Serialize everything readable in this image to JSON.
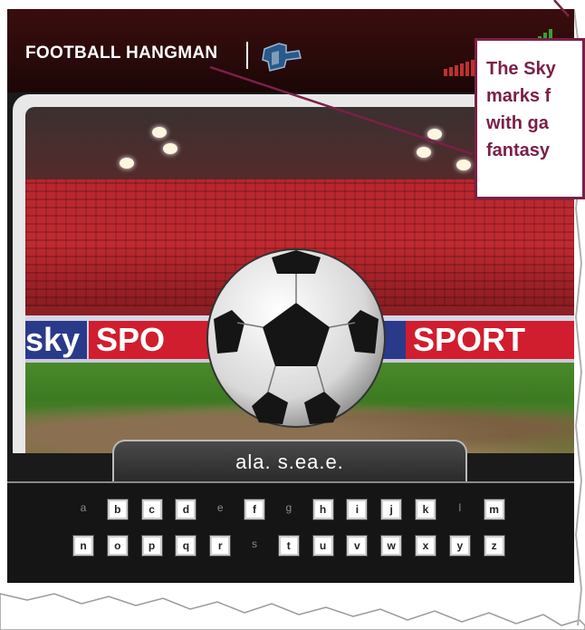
{
  "game": {
    "title": "FOOTBALL HANGMAN",
    "ad_boards": [
      "sky",
      "SPO",
      "SPORT"
    ],
    "masked_word": "ala. s.ea.e."
  },
  "keyboard": {
    "row1": [
      {
        "letter": "a",
        "used": true
      },
      {
        "letter": "b",
        "used": false
      },
      {
        "letter": "c",
        "used": false
      },
      {
        "letter": "d",
        "used": false
      },
      {
        "letter": "e",
        "used": true
      },
      {
        "letter": "f",
        "used": false
      },
      {
        "letter": "g",
        "used": true
      },
      {
        "letter": "h",
        "used": false
      },
      {
        "letter": "i",
        "used": false
      },
      {
        "letter": "j",
        "used": false
      },
      {
        "letter": "k",
        "used": false
      },
      {
        "letter": "l",
        "used": true
      },
      {
        "letter": "m",
        "used": false
      }
    ],
    "row2": [
      {
        "letter": "n",
        "used": false
      },
      {
        "letter": "o",
        "used": false
      },
      {
        "letter": "p",
        "used": false
      },
      {
        "letter": "q",
        "used": false
      },
      {
        "letter": "r",
        "used": false
      },
      {
        "letter": "s",
        "used": true
      },
      {
        "letter": "t",
        "used": false
      },
      {
        "letter": "u",
        "used": false
      },
      {
        "letter": "v",
        "used": false
      },
      {
        "letter": "w",
        "used": false
      },
      {
        "letter": "x",
        "used": false
      },
      {
        "letter": "y",
        "used": false
      },
      {
        "letter": "z",
        "used": false
      }
    ]
  },
  "callout": {
    "lines": [
      "The Sky",
      "marks f",
      "with ga",
      "fantasy"
    ]
  },
  "colors": {
    "callout_accent": "#7a2048",
    "ad_red": "#d01e2e",
    "ad_blue": "#2a3a8a",
    "header_bg": "#2a0a0a"
  },
  "icons": {
    "logo": "brand-logo-icon",
    "signal_meter": "signal-meter-icon",
    "ball": "soccer-ball",
    "keeper": "goalkeeper-figure"
  }
}
